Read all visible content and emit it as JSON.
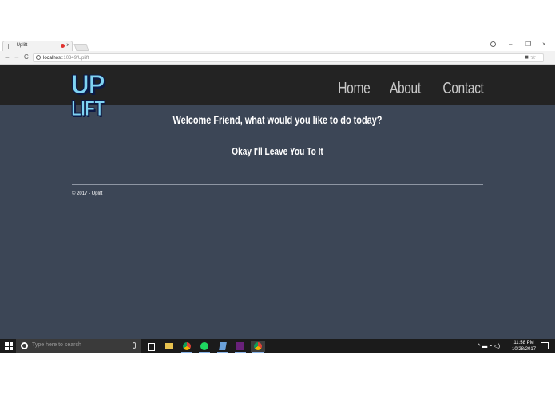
{
  "browser": {
    "tab_title": "· Uplift",
    "tab_close": "×",
    "window_minimize": "–",
    "window_maximize": "❐",
    "window_close": "×",
    "nav_back": "←",
    "nav_forward": "→",
    "nav_reload": "C",
    "url_host": "localhost",
    "url_path": ":10349/Uplift",
    "toolbar_icons": "■ ☆ ⋮"
  },
  "site": {
    "logo_top": "UP",
    "logo_bottom": "LIFT",
    "nav": [
      "Home",
      "About",
      "Contact"
    ],
    "welcome": "Welcome Friend, what would you like to do today?",
    "status_message": "Okay I'll Leave You To It",
    "footer": "© 2017 - Uplift"
  },
  "taskbar": {
    "search_placeholder": "Type here to search",
    "tray_icons": "^ ▬ ◔ ◁)",
    "clock_time": "11:58 PM",
    "clock_date": "10/28/2017"
  },
  "colors": {
    "header_bg": "#232323",
    "page_bg": "#3c4656",
    "logo_fill": "#7fd3f2",
    "nav_text": "#c9c9c9"
  }
}
